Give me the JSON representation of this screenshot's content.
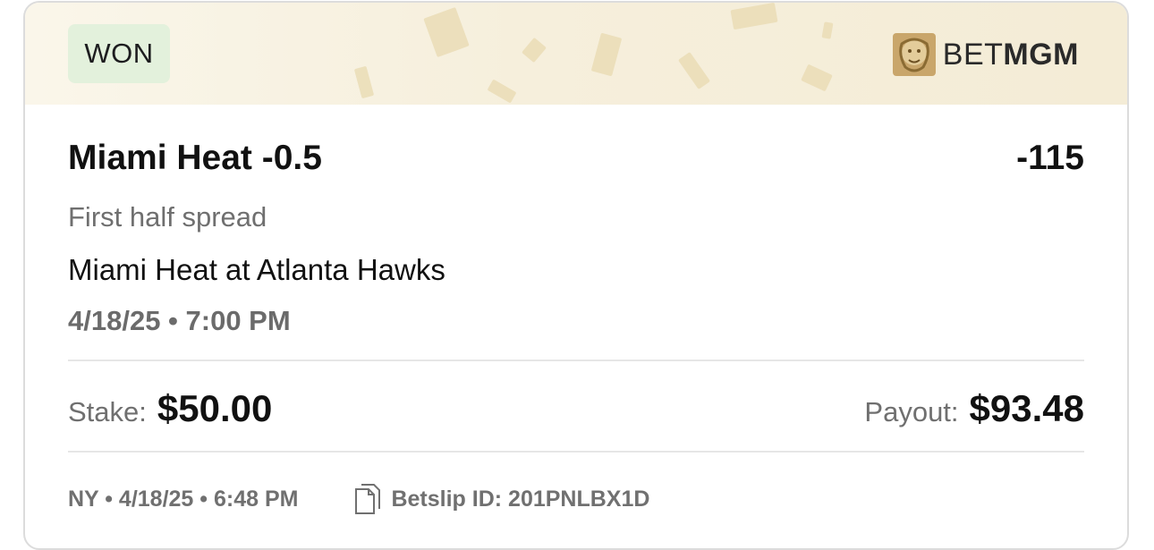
{
  "status_badge": "WON",
  "brand": {
    "light": "BET",
    "bold": "MGM",
    "icon": "lion-logo-icon"
  },
  "bet": {
    "selection": "Miami Heat -0.5",
    "odds": "-115",
    "market": "First half spread",
    "event": "Miami Heat at Atlanta Hawks",
    "event_time": "4/18/25 • 7:00 PM"
  },
  "stake": {
    "label": "Stake:",
    "value": "$50.00"
  },
  "payout": {
    "label": "Payout:",
    "value": "$93.48"
  },
  "footer": {
    "placed": "NY • 4/18/25 • 6:48 PM",
    "betslip": "Betslip ID: 201PNLBX1D",
    "icon": "document-copy-icon"
  },
  "colors": {
    "badge_bg": "#e3f1dc",
    "banner_gold": "#f4ecd6",
    "brand_gold": "#c9a66b"
  }
}
